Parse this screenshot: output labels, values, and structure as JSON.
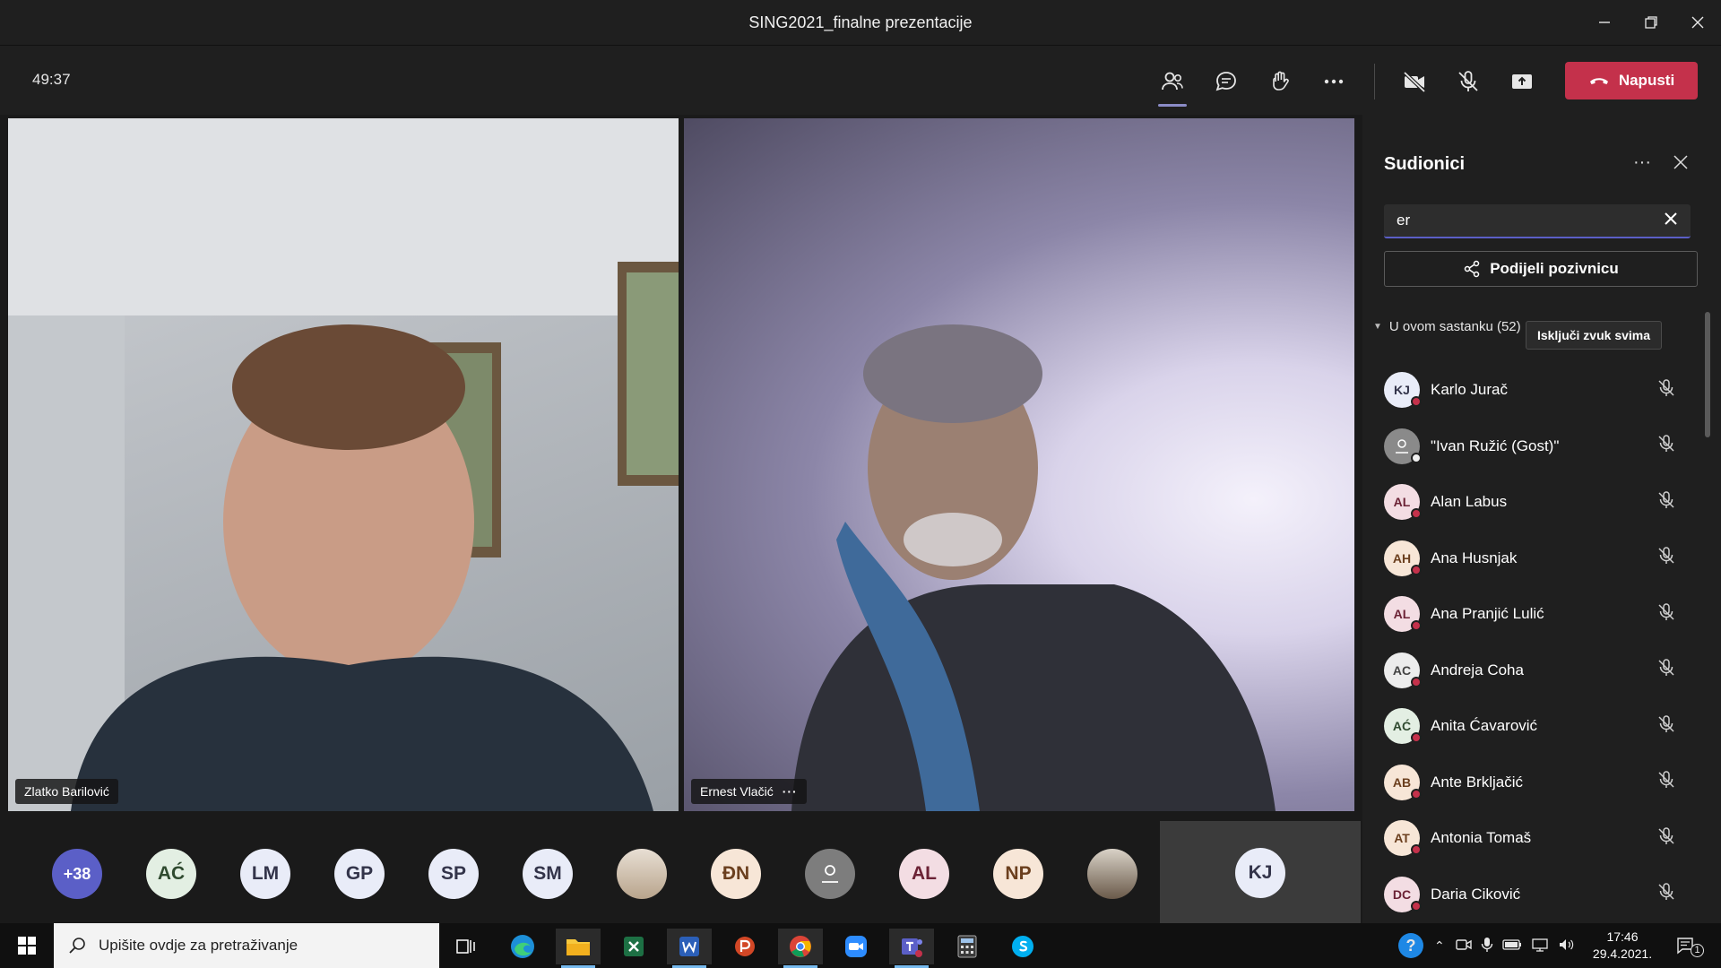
{
  "window": {
    "title": "SING2021_finalne prezentacije"
  },
  "toolbar": {
    "timer": "49:37",
    "leave_label": "Napusti"
  },
  "videos": [
    {
      "name": "Zlatko Barilović"
    },
    {
      "name": "Ernest Vlačić",
      "more": "···"
    }
  ],
  "strip": {
    "overflow": "+38",
    "avatars": [
      "AĆ",
      "LM",
      "GP",
      "SP",
      "SM",
      "ĐN",
      "AL",
      "NP"
    ],
    "featured": "KJ"
  },
  "panel": {
    "title": "Sudionici",
    "more": "···",
    "search_value": "er",
    "share_label": "Podijeli pozivnicu",
    "section_label": "U ovom sastanku (52)",
    "mute_all_label": "Isključi zvuk svima",
    "participants": [
      {
        "initials": "KJ",
        "name": "Karlo Jurač"
      },
      {
        "initials": "",
        "name": "\"Ivan Ružić (Gost)\""
      },
      {
        "initials": "AL",
        "name": "Alan Labus"
      },
      {
        "initials": "AH",
        "name": "Ana Husnjak"
      },
      {
        "initials": "AL",
        "name": "Ana Pranjić Lulić"
      },
      {
        "initials": "AC",
        "name": "Andreja Coha"
      },
      {
        "initials": "AĆ",
        "name": "Anita Ćavarović"
      },
      {
        "initials": "AB",
        "name": "Ante Brkljačić"
      },
      {
        "initials": "AT",
        "name": "Antonia Tomaš"
      },
      {
        "initials": "DC",
        "name": "Daria Ciković"
      }
    ]
  },
  "taskbar": {
    "search_placeholder": "Upišite ovdje za pretraživanje",
    "time": "17:46",
    "date": "29.4.2021.",
    "notif_count": "1"
  },
  "colors": {
    "accent": "#5b5fc7",
    "leave": "#c4314b",
    "panel_bg": "#1f1f1f"
  }
}
